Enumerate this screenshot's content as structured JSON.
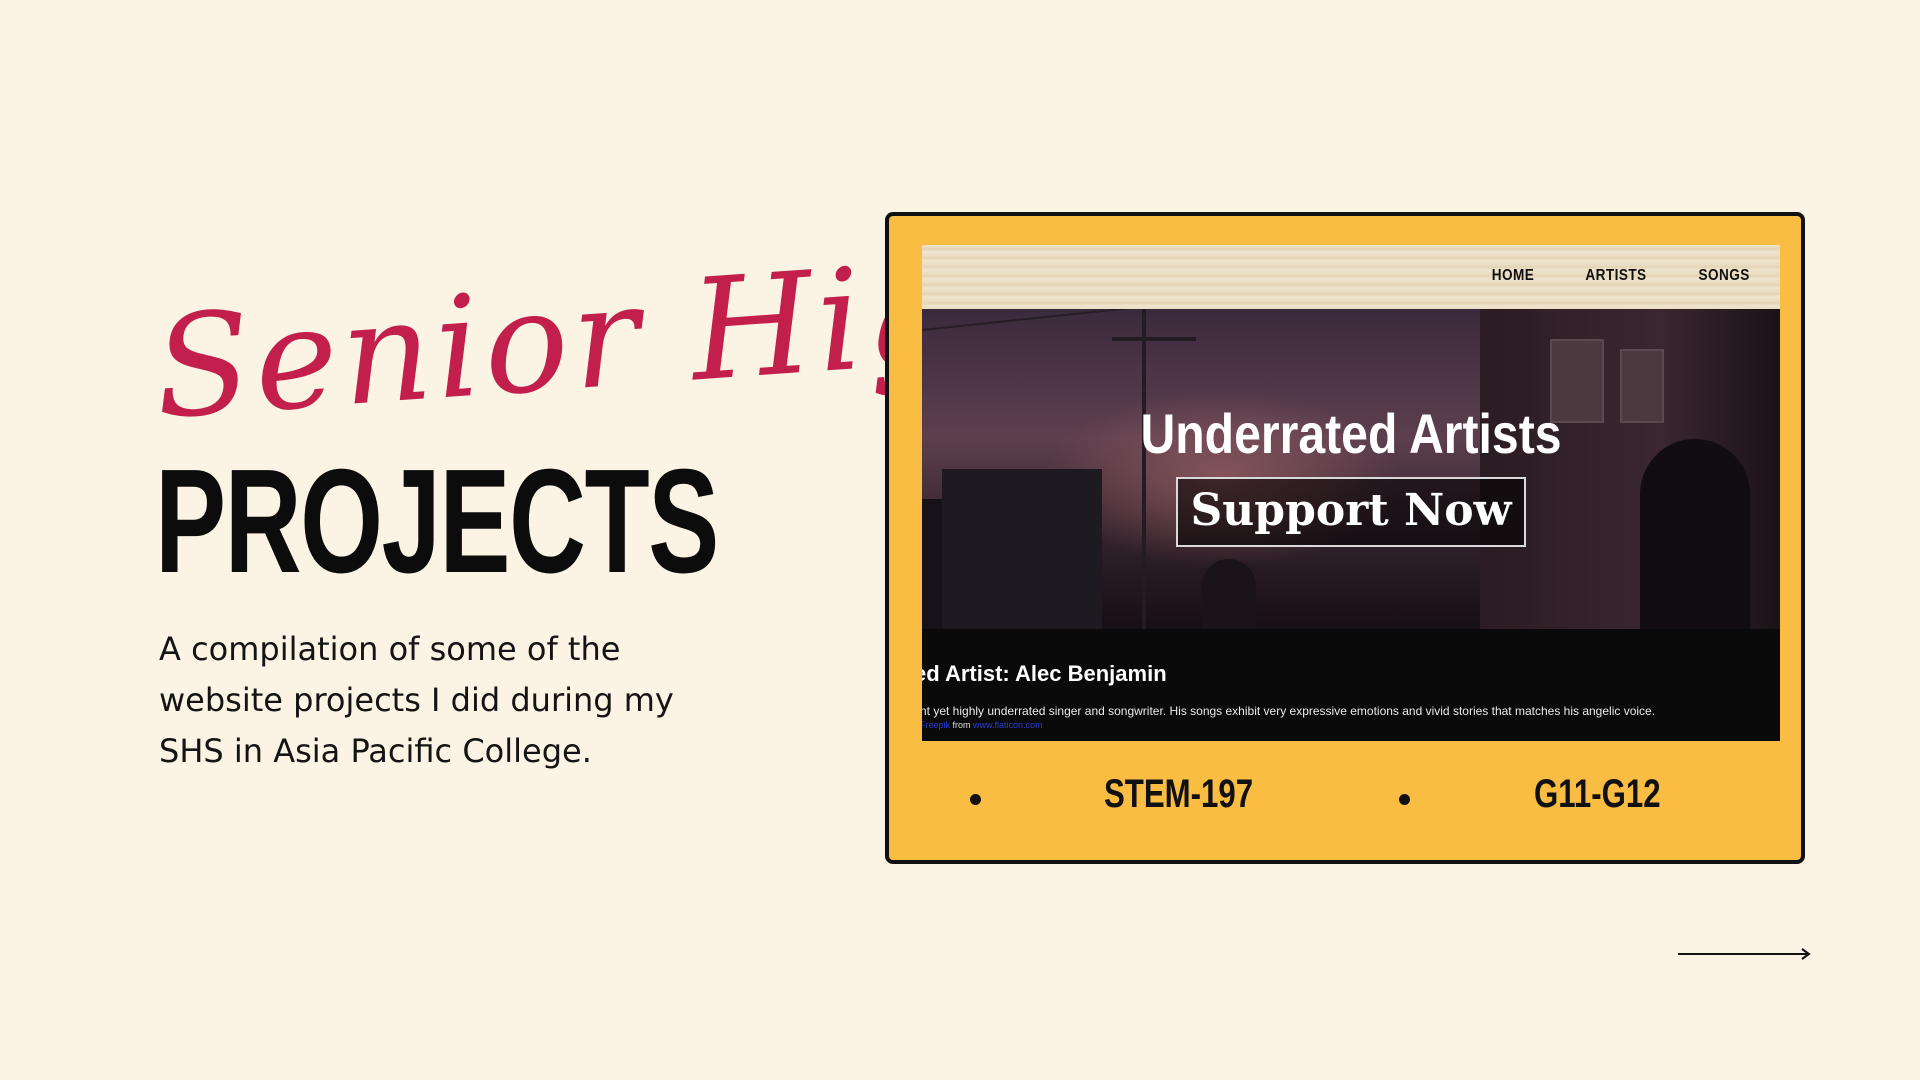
{
  "slide": {
    "script_title": "Senior High",
    "title": "PROJECTS",
    "description": "A compilation of some of the website projects I did during my SHS in Asia Pacific College."
  },
  "preview": {
    "nav": {
      "home": "HOME",
      "artists": "ARTISTS",
      "songs": "SONGS"
    },
    "hero_title": "Underrated Artists",
    "hero_button": "Support Now",
    "feature_title": "ed Artist: Alec Benjamin",
    "feature_text": "nt yet highly underrated singer and songwriter. His songs exhibit very expressive emotions and vivid stories that matches his angelic voice.",
    "credit_link": "Freepik",
    "credit_from": "from",
    "credit_site": "www.flaticon.com"
  },
  "tags": [
    "STEM-197",
    "G11-G12"
  ],
  "icons": {
    "next": "arrow-right-icon",
    "bullet": "bullet-icon"
  },
  "colors": {
    "background": "#fbf3e3",
    "accent": "#c21f4c",
    "card": "#f8bd42",
    "text": "#0c0c0c"
  }
}
